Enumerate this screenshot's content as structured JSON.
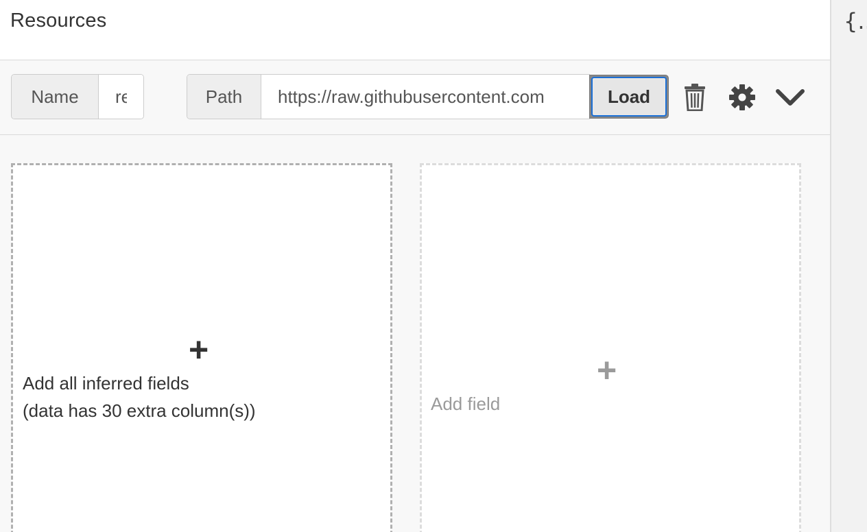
{
  "header": {
    "title": "Resources"
  },
  "toolbar": {
    "name_label": "Name",
    "name_value": "re",
    "path_label": "Path",
    "path_value": "https://raw.githubusercontent.com",
    "load_label": "Load",
    "icons": [
      "trash-icon",
      "gear-icon",
      "chevron-down-icon"
    ]
  },
  "cards": {
    "inferred": {
      "plus": "+",
      "line1": "Add all inferred fields",
      "line2": "(data has 30 extra column(s))"
    },
    "add_field": {
      "plus": "+",
      "label": "Add field"
    }
  },
  "side_panel": {
    "icon": "{...}"
  },
  "colors": {
    "focus_blue": "#1a6fd6",
    "muted_text": "#9a9a9a"
  }
}
